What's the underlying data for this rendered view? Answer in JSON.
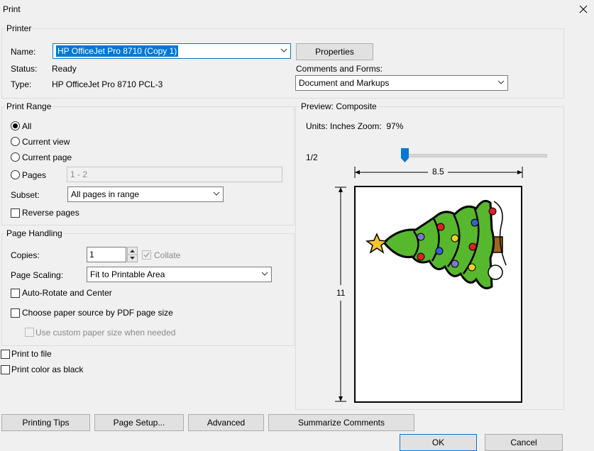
{
  "window": {
    "title": "Print"
  },
  "printer": {
    "legend": "Printer",
    "name_label": "Name:",
    "name_value": "HP OfficeJet Pro 8710 (Copy 1)",
    "properties_label": "Properties",
    "status_label": "Status:",
    "status_value": "Ready",
    "type_label": "Type:",
    "type_value": "HP OfficeJet Pro 8710 PCL-3",
    "comments_label": "Comments and Forms:",
    "comments_value": "Document and Markups"
  },
  "print_range": {
    "legend": "Print Range",
    "all": "All",
    "current_view": "Current view",
    "current_page": "Current page",
    "pages": "Pages",
    "pages_value": "1 - 2",
    "subset_label": "Subset:",
    "subset_value": "All pages in range",
    "reverse_pages": "Reverse pages"
  },
  "page_handling": {
    "legend": "Page Handling",
    "copies_label": "Copies:",
    "copies_value": "1",
    "collate": "Collate",
    "scaling_label": "Page Scaling:",
    "scaling_value": "Fit to Printable Area",
    "auto_rotate": "Auto-Rotate and Center",
    "choose_source": "Choose paper source by PDF page size",
    "custom_paper": "Use custom paper size when needed"
  },
  "options": {
    "print_to_file": "Print to file",
    "print_color_black": "Print color as black"
  },
  "preview": {
    "legend": "Preview: Composite",
    "units_zoom": "Units: Inches Zoom:  97%",
    "page_indicator": "1/2",
    "width_label": "8.5",
    "height_label": "11",
    "slider_position": 0.0
  },
  "buttons": {
    "printing_tips": "Printing Tips",
    "page_setup": "Page Setup...",
    "advanced": "Advanced",
    "summarize": "Summarize Comments",
    "ok": "OK",
    "cancel": "Cancel"
  }
}
